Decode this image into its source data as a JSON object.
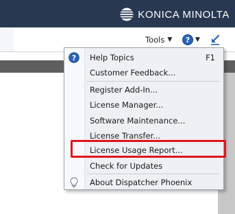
{
  "brand": {
    "name": "KONICA MINOLTA",
    "logo_icon": "konica-minolta-globe-icon",
    "header_color": "#283850"
  },
  "toolbar": {
    "tools_label": "Tools",
    "tools_caret": "▼",
    "help_icon": "help-circle-icon",
    "help_glyph": "?",
    "help_caret": "▼",
    "minimize_icon": "minimize-arrow-icon"
  },
  "menu": {
    "items": [
      {
        "label": "Help Topics",
        "shortcut": "F1",
        "icon": "help-circle-icon"
      },
      {
        "label": "Customer Feedback..."
      },
      {
        "label": "Register Add-In..."
      },
      {
        "label": "License Manager..."
      },
      {
        "label": "Software Maintenance..."
      },
      {
        "label": "License Transfer..."
      },
      {
        "label": "License Usage Report...",
        "highlighted": true
      },
      {
        "label": "Check for Updates"
      },
      {
        "label": "About Dispatcher Phoenix",
        "icon": "lightbulb-icon"
      }
    ]
  },
  "colors": {
    "accent": "#2a62b8",
    "highlight": "#e0141b"
  }
}
